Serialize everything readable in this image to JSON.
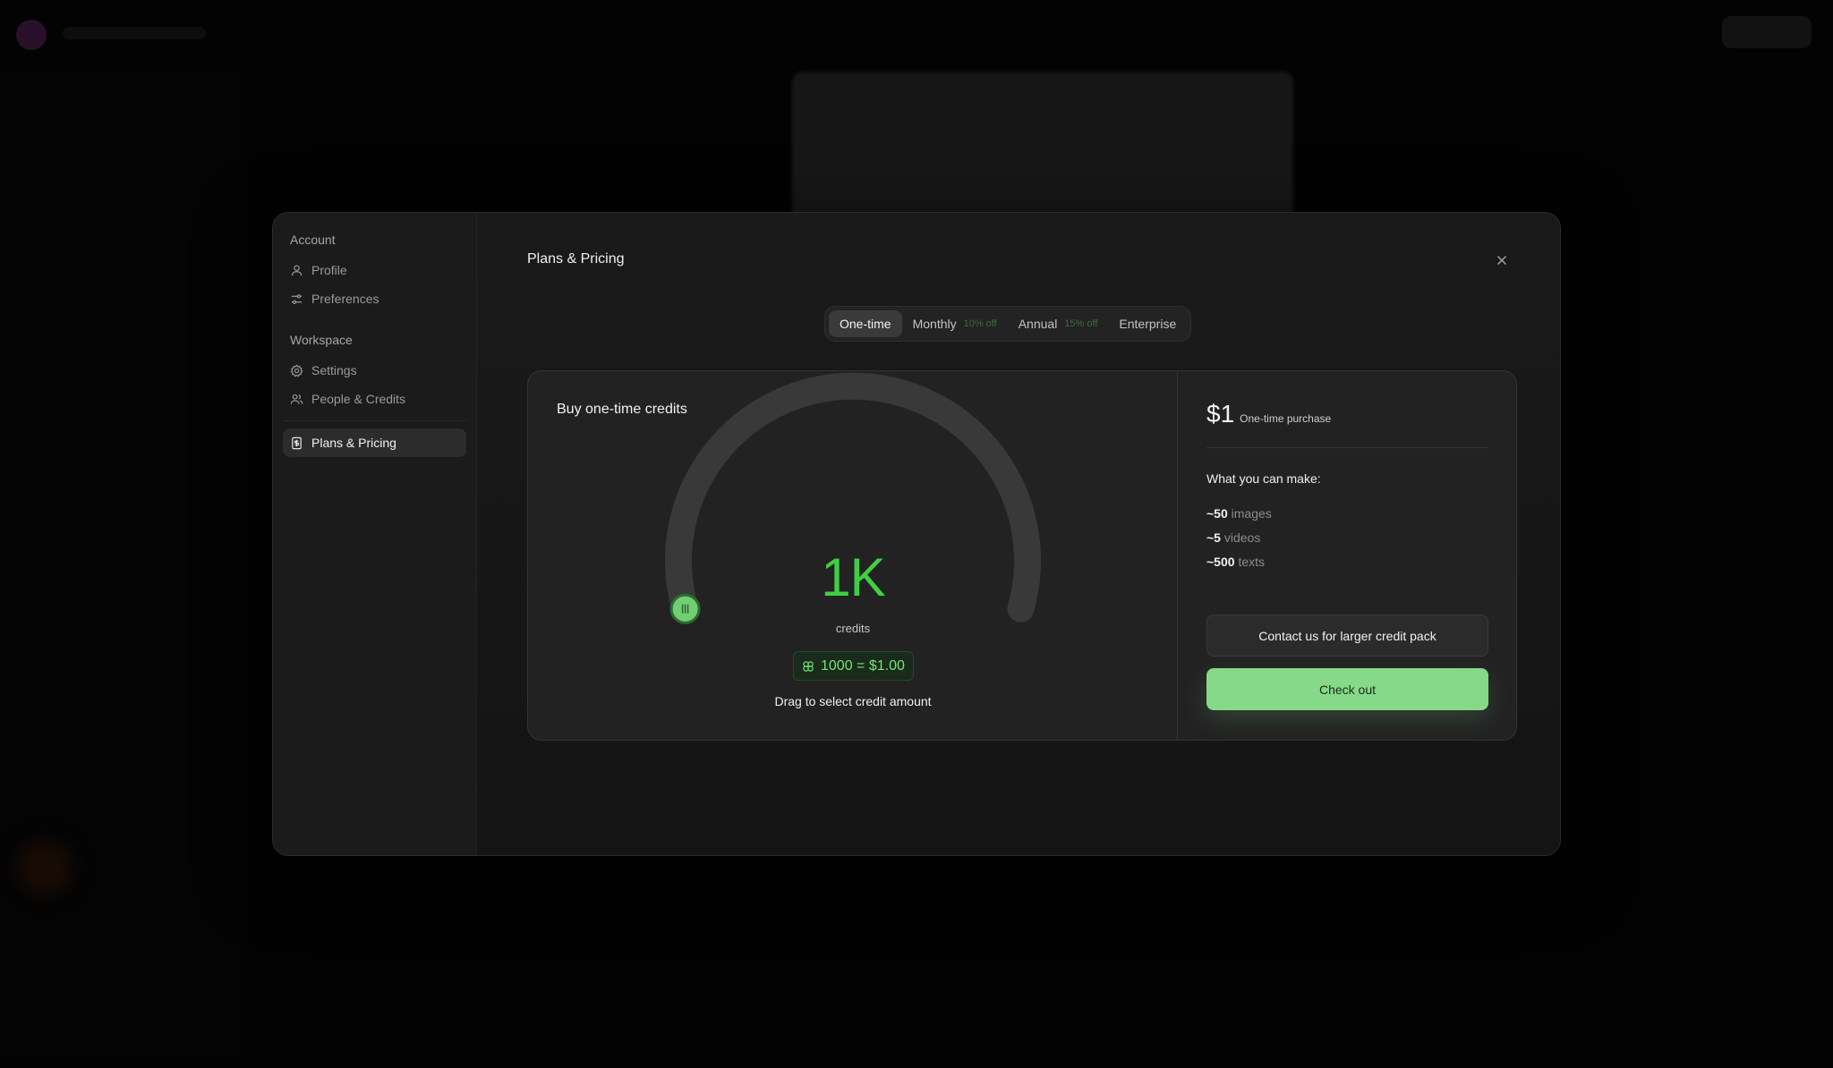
{
  "sidebar": {
    "account_heading": "Account",
    "account_items": [
      {
        "label": "Profile",
        "icon": "user-icon"
      },
      {
        "label": "Preferences",
        "icon": "sliders-icon"
      }
    ],
    "workspace_heading": "Workspace",
    "workspace_items": [
      {
        "label": "Settings",
        "icon": "gear-icon"
      },
      {
        "label": "People & Credits",
        "icon": "users-icon"
      }
    ],
    "active_item": {
      "label": "Plans & Pricing",
      "icon": "receipt-icon"
    }
  },
  "modal": {
    "title": "Plans & Pricing",
    "close_icon": "close-icon"
  },
  "tabs": [
    {
      "label": "One-time",
      "discount": "",
      "active": true
    },
    {
      "label": "Monthly",
      "discount": "10% off",
      "active": false
    },
    {
      "label": "Annual",
      "discount": "15% off",
      "active": false
    },
    {
      "label": "Enterprise",
      "discount": "",
      "active": false
    }
  ],
  "credits_panel": {
    "title": "Buy one-time credits",
    "value": "1K",
    "unit": "credits",
    "rate": "1000 = $1.00",
    "rate_icon": "credits-icon",
    "hint": "Drag to select credit amount",
    "slider_fraction": 0.0,
    "handle_icon": "grip-icon"
  },
  "summary": {
    "price": "$1",
    "price_note": "One-time purchase",
    "make_title": "What you can make:",
    "items": [
      {
        "amount": "~50",
        "unit": "images"
      },
      {
        "amount": "~5",
        "unit": "videos"
      },
      {
        "amount": "~500",
        "unit": "texts"
      }
    ],
    "contact_label": "Contact us for larger credit pack",
    "checkout_label": "Check out"
  },
  "colors": {
    "accent_green": "#3fcf44",
    "checkout_green": "#86d988",
    "modal_bg": "#151515",
    "sidebar_bg": "#1b1b1b"
  }
}
